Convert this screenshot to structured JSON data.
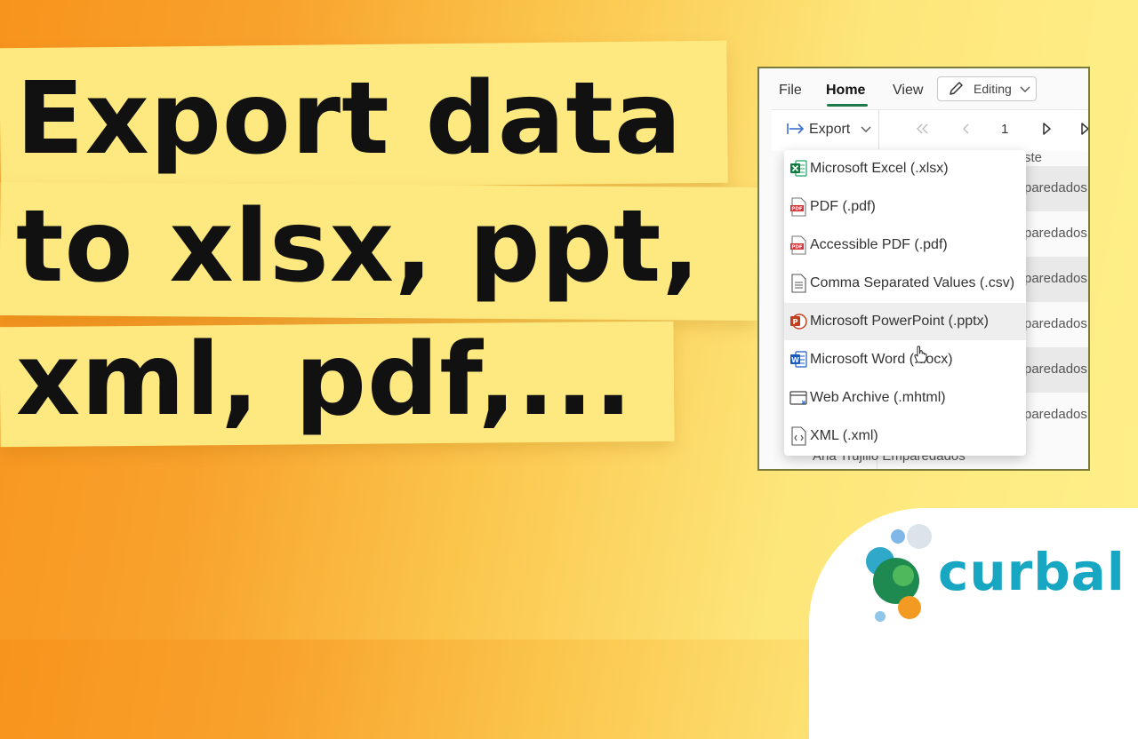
{
  "headline": {
    "line1": "Export data",
    "line2": "to xlsx, ppt,",
    "line3": "xml, pdf,..."
  },
  "ribbon": {
    "tabs": [
      "File",
      "Home",
      "View"
    ],
    "active_tab": "Home",
    "editing_label": "Editing"
  },
  "toolbar": {
    "export_label": "Export",
    "page_number": "1"
  },
  "export_menu": {
    "items": [
      {
        "label": "Microsoft Excel (.xlsx)",
        "icon": "excel-icon"
      },
      {
        "label": "PDF (.pdf)",
        "icon": "pdf-icon"
      },
      {
        "label": "Accessible PDF (.pdf)",
        "icon": "pdf-icon"
      },
      {
        "label": "Comma Separated Values (.csv)",
        "icon": "csv-file-icon"
      },
      {
        "label": "Microsoft PowerPoint (.pptx)",
        "icon": "powerpoint-icon"
      },
      {
        "label": "Microsoft Word (.docx)",
        "icon": "word-icon"
      },
      {
        "label": "Web Archive (.mhtml)",
        "icon": "web-archive-icon"
      },
      {
        "label": "XML (.xml)",
        "icon": "xml-file-icon"
      }
    ],
    "hovered_item": "Microsoft PowerPoint (.pptx)"
  },
  "background_grid": {
    "top_cell": "ste",
    "cells": [
      "paredados",
      "paredados",
      "paredados",
      "paredados",
      "paredados",
      "paredados"
    ],
    "bottom_row": "Ana Trujillo Emparedados"
  },
  "logo": {
    "text": "curbal"
  },
  "colors": {
    "banner": "#fde97f",
    "accent_green": "#1f7a4a",
    "logo_teal": "#17a7c3",
    "background_orange": "#f7941d"
  }
}
